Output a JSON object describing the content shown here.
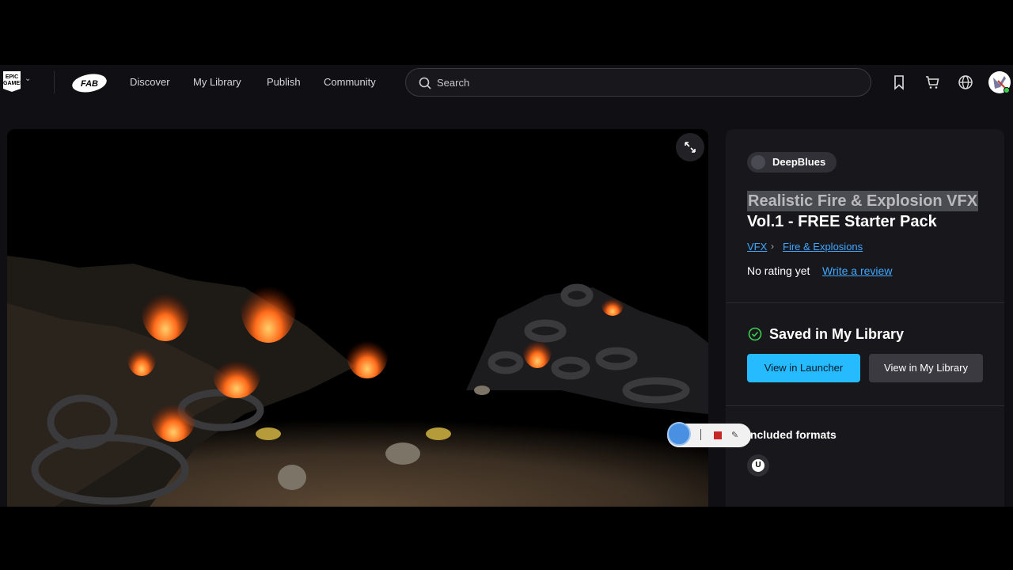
{
  "nav": {
    "epic_logo_text": "EPIC GAMES",
    "fab_logo_text": "FAB",
    "links": [
      "Discover",
      "My Library",
      "Publish",
      "Community"
    ],
    "search_placeholder": "Search"
  },
  "product": {
    "seller": "DeepBlues",
    "title_line1": "Realistic Fire & Explosion VFX",
    "title_line2": "Vol.1 - FREE Starter Pack",
    "breadcrumbs": [
      "VFX",
      "Fire & Explosions"
    ],
    "rating_text": "No rating yet",
    "review_link": "Write a review",
    "saved_status": "Saved in My Library",
    "btn_launcher": "View in Launcher",
    "btn_library": "View in My Library",
    "formats_title": "Included formats",
    "format_icon": "unreal-engine-icon"
  },
  "colors": {
    "accent_blue": "#26bbff",
    "link_blue": "#3fa7ff",
    "success_green": "#3ccf4e"
  }
}
